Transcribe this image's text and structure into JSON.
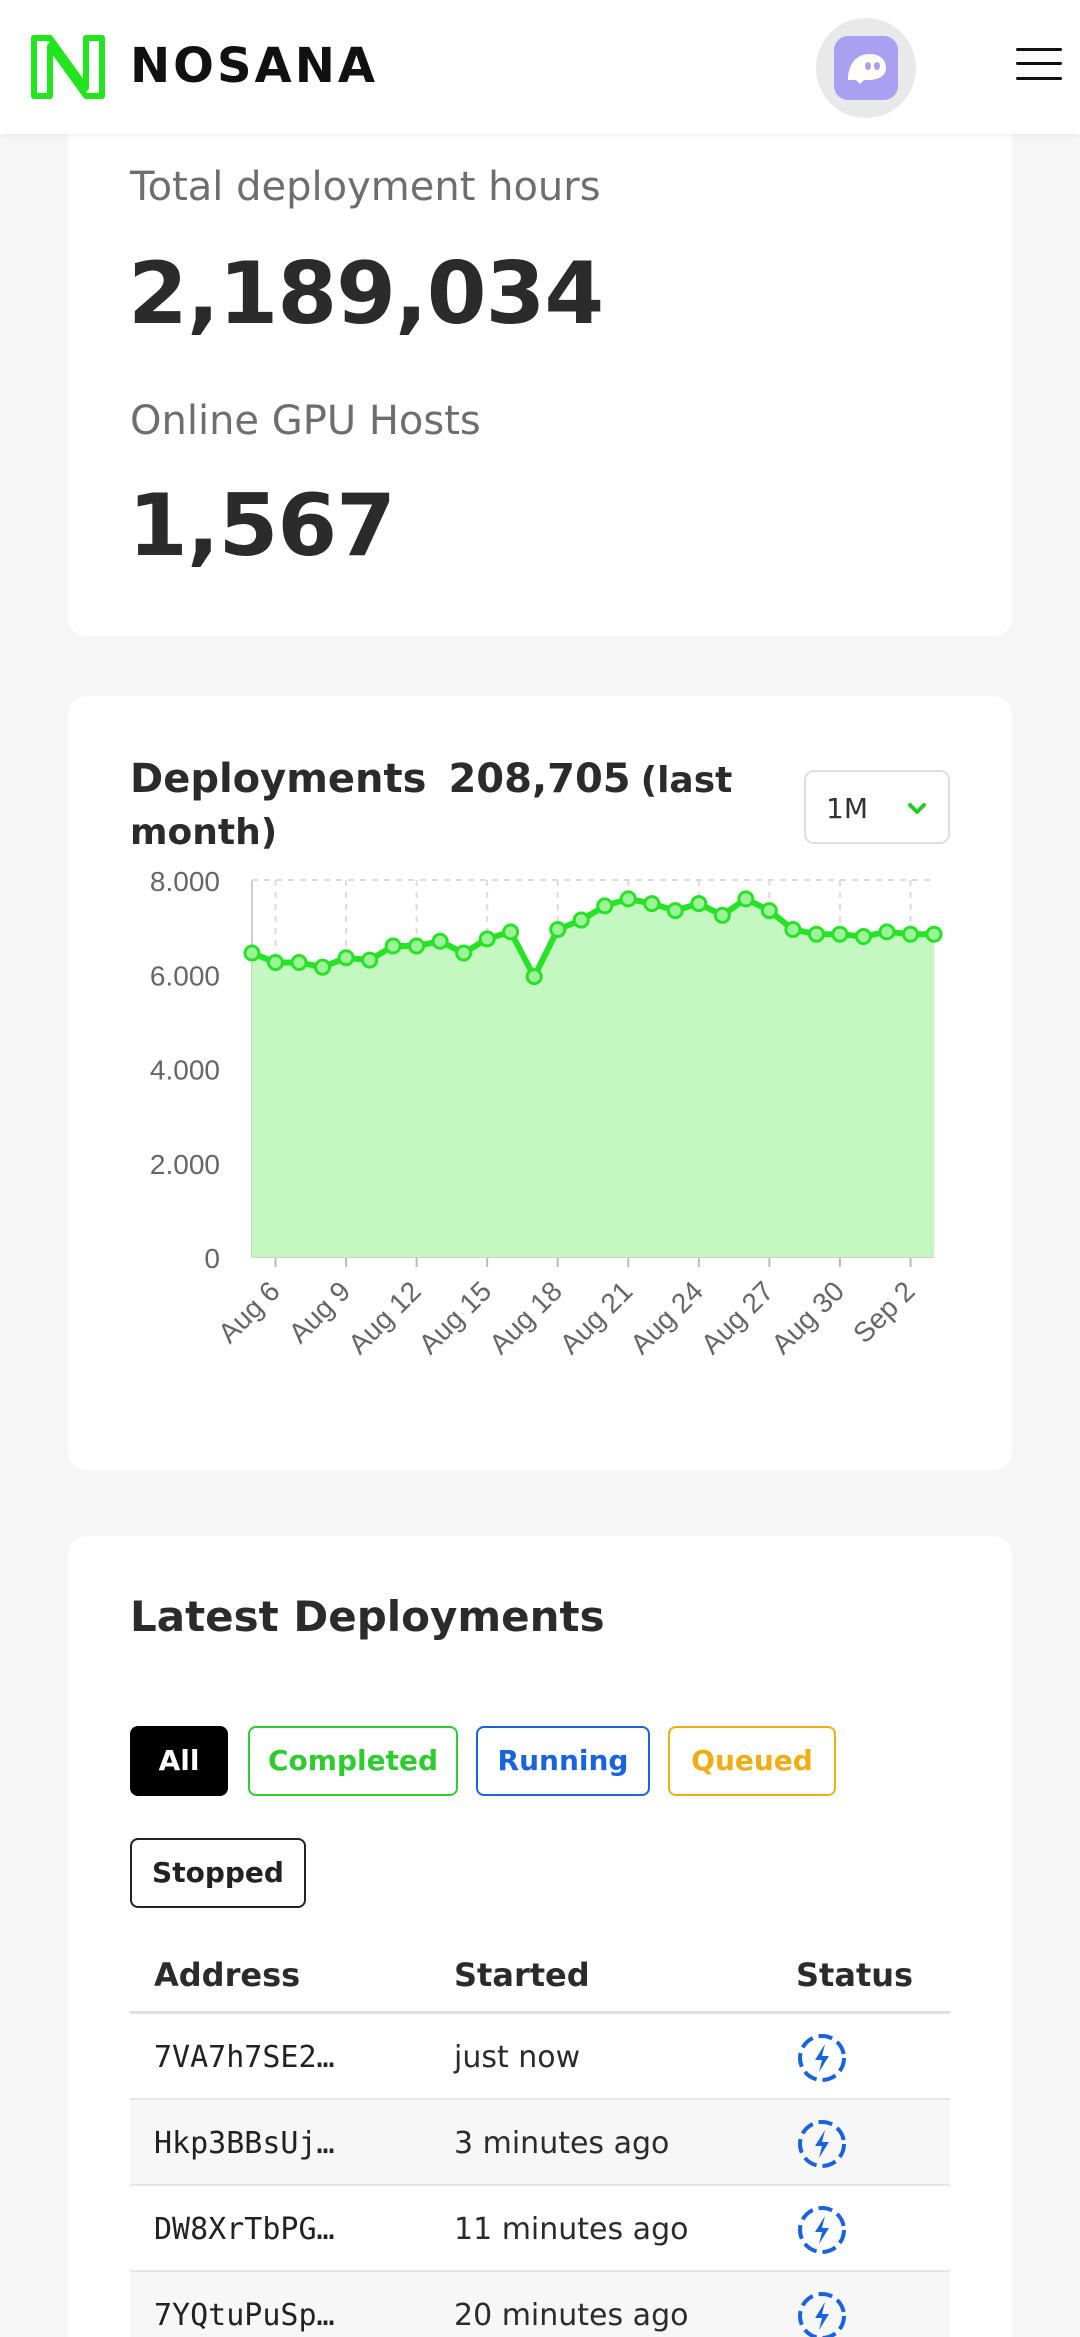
{
  "header": {
    "brand": "NOSANA",
    "logo_icon": "nosana-logo-icon",
    "avatar_icon": "ghost-wallet-icon",
    "menu_icon": "hamburger-menu-icon",
    "brand_color": "#22e51e"
  },
  "stats": {
    "total_hours_label": "Total deployment hours",
    "total_hours_value": "2,189,034",
    "gpu_hosts_label": "Online GPU Hosts",
    "gpu_hosts_value": "1,567"
  },
  "deployments": {
    "title": "Deployments",
    "count": "208,705",
    "suffix": "(last month)",
    "range": "1M",
    "range_icon": "chevron-down-icon"
  },
  "chart_data": {
    "type": "area",
    "title": "",
    "xlabel": "",
    "ylabel": "",
    "ylim": [
      0,
      8000
    ],
    "yticks": [
      "0",
      "2.000",
      "4.000",
      "6.000",
      "8.000"
    ],
    "xticks": [
      "Aug 6",
      "Aug 9",
      "Aug 12",
      "Aug 15",
      "Aug 18",
      "Aug 21",
      "Aug 24",
      "Aug 27",
      "Aug 30",
      "Sep 2"
    ],
    "x": [
      "Aug 5",
      "Aug 6",
      "Aug 7",
      "Aug 8",
      "Aug 9",
      "Aug 10",
      "Aug 11",
      "Aug 12",
      "Aug 13",
      "Aug 14",
      "Aug 15",
      "Aug 16",
      "Aug 17",
      "Aug 18",
      "Aug 19",
      "Aug 20",
      "Aug 21",
      "Aug 22",
      "Aug 23",
      "Aug 24",
      "Aug 25",
      "Aug 26",
      "Aug 27",
      "Aug 28",
      "Aug 29",
      "Aug 30",
      "Aug 31",
      "Sep 1",
      "Sep 2",
      "Sep 3"
    ],
    "series": [
      {
        "values": [
          6450,
          6250,
          6250,
          6150,
          6350,
          6300,
          6600,
          6600,
          6700,
          6450,
          6750,
          6900,
          5950,
          6950,
          7150,
          7450,
          7600,
          7500,
          7350,
          7500,
          7250,
          7600,
          7350,
          6950,
          6850,
          6850,
          6800,
          6900,
          6850,
          6850
        ],
        "color": "#27e227",
        "fill": "#c3f8c0"
      }
    ],
    "grid": true
  },
  "latest": {
    "title": "Latest Deployments",
    "filters": {
      "all": "All",
      "completed": "Completed",
      "running": "Running",
      "queued": "Queued",
      "stopped": "Stopped"
    },
    "columns": {
      "address": "Address",
      "started": "Started",
      "status": "Status"
    },
    "rows": [
      {
        "address": "7VA7h7SE2…",
        "started": "just now",
        "status_icon": "running-status-icon"
      },
      {
        "address": "Hkp3BBsUj…",
        "started": "3 minutes ago",
        "status_icon": "running-status-icon"
      },
      {
        "address": "DW8XrTbPG…",
        "started": "11 minutes ago",
        "status_icon": "running-status-icon"
      },
      {
        "address": "7YQtuPuSp…",
        "started": "20 minutes ago",
        "status_icon": "running-status-icon"
      }
    ]
  }
}
